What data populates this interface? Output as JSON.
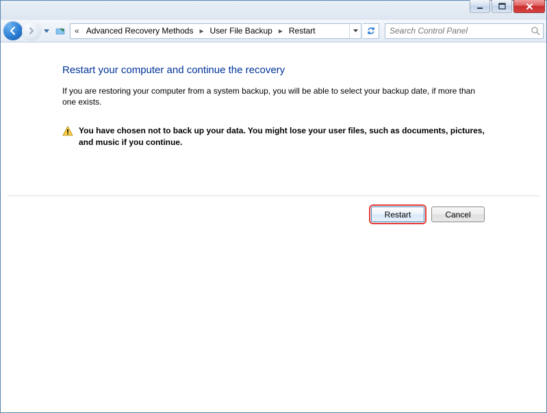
{
  "breadcrumb": {
    "seg1": "Advanced Recovery Methods",
    "seg2": "User File Backup",
    "seg3": "Restart"
  },
  "search": {
    "placeholder": "Search Control Panel"
  },
  "main": {
    "heading": "Restart your computer and continue the recovery",
    "description": "If you are restoring your computer from a system backup, you will be able to select your backup date, if more than one exists.",
    "warning": "You have chosen not to back up your data. You might lose your user files, such as documents, pictures, and music if you continue."
  },
  "buttons": {
    "restart": "Restart",
    "cancel": "Cancel"
  }
}
